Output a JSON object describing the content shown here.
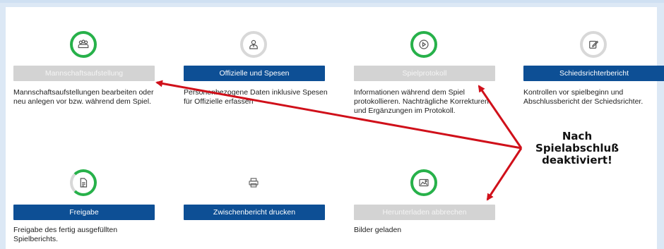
{
  "tiles": [
    {
      "key": "mannschaft",
      "button": "Mannschaftsaufstellung",
      "desc": "Mannschaftsaufstellungen bearbeiten oder neu anlegen vor bzw. während dem Spiel.",
      "icon": "team-icon",
      "ring": "green",
      "state": "disabled"
    },
    {
      "key": "offizielle",
      "button": "Offizielle und Spesen",
      "desc": "Personenbezogene Daten inklusive Spesen für Offizielle erfassen",
      "icon": "official-person-icon",
      "ring": "gray",
      "state": "active"
    },
    {
      "key": "spielprotokoll",
      "button": "Spielprotokoll",
      "desc": "Informationen während dem Spiel protokollieren. Nachträgliche Korrekturen und Ergänzungen im Protokoll.",
      "icon": "play-icon",
      "ring": "green",
      "state": "disabled"
    },
    {
      "key": "schiedsrichter",
      "button": "Schiedsrichterbericht",
      "desc": "Kontrollen vor spielbeginn und Abschlussbericht der Schiedsrichter.",
      "icon": "edit-icon",
      "ring": "gray",
      "state": "active"
    },
    {
      "key": "freigabe",
      "button": "Freigabe",
      "desc": "Freigabe des fertig ausgefüllten Spielberichts.",
      "icon": "document-icon",
      "ring": "partial",
      "state": "active"
    },
    {
      "key": "zwischenbericht",
      "button": "Zwischenbericht drucken",
      "desc": "",
      "icon": "printer-icon",
      "ring": "none",
      "state": "active"
    },
    {
      "key": "herunterladen",
      "button": "Herunterladen abbrechen",
      "desc": "Bilder geladen",
      "icon": "image-icon",
      "ring": "green",
      "state": "disabled"
    }
  ],
  "annotation": {
    "line1": "Nach",
    "line2": "Spielabschluß",
    "line3": "deaktiviert!",
    "color": "#d0101a"
  },
  "colors": {
    "primary": "#0d4f95",
    "disabled": "#d3d3d3",
    "success": "#27b14a"
  }
}
